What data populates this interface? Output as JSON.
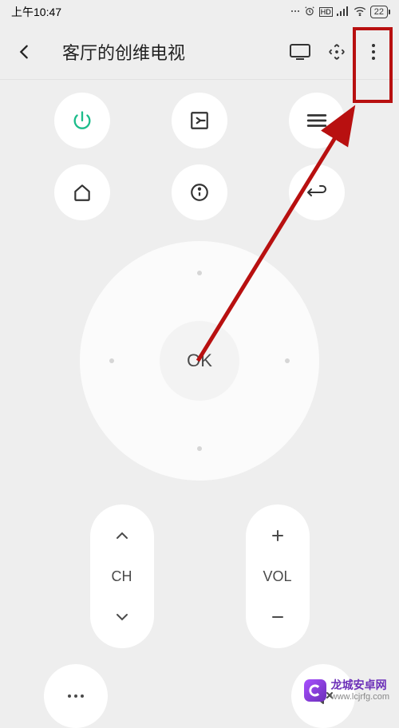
{
  "status": {
    "time": "上午10:47",
    "battery": "22"
  },
  "header": {
    "title": "客厅的创维电视"
  },
  "dpad": {
    "ok_label": "OK"
  },
  "controls": {
    "ch_label": "CH",
    "vol_label": "VOL"
  },
  "watermark": {
    "title": "龙城安卓网",
    "url": "www.lcjrfg.com"
  },
  "icon_names": {
    "power": "power-icon",
    "input": "input-icon",
    "menu": "menu-icon",
    "home": "home-icon",
    "info": "info-icon",
    "back": "back-icon",
    "mute": "mute-icon",
    "more_dots": "more-icon"
  }
}
